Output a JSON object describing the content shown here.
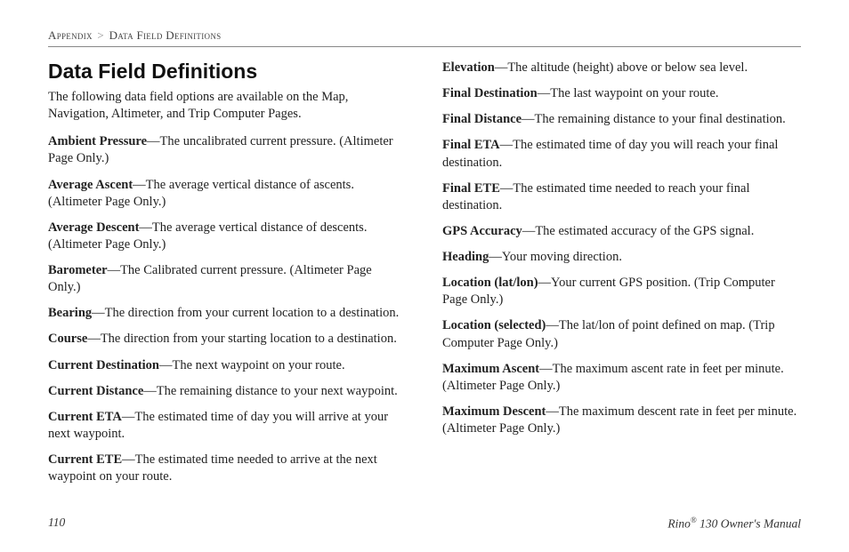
{
  "breadcrumb": {
    "part1": "Appendix",
    "sep": ">",
    "part2": "Data Field Definitions"
  },
  "title": "Data Field Definitions",
  "intro": "The following data field options are available on the Map, Navigation, Altimeter, and Trip Computer Pages.",
  "entries": [
    {
      "term": "Ambient Pressure",
      "def": "—The uncalibrated current pressure. (Altimeter Page Only.)"
    },
    {
      "term": "Average Ascent",
      "def": "—The average vertical distance of ascents. (Altimeter Page Only.)"
    },
    {
      "term": "Average Descent",
      "def": "—The average vertical distance of descents. (Altimeter Page Only.)"
    },
    {
      "term": "Barometer",
      "def": "—The Calibrated current pressure. (Altimeter Page Only.)"
    },
    {
      "term": "Bearing",
      "def": "—The direction from your current location to a destination."
    },
    {
      "term": "Course",
      "def": "—The direction from your starting location to a destination."
    },
    {
      "term": "Current Destination",
      "def": "—The next waypoint on your route."
    },
    {
      "term": "Current Distance",
      "def": "—The remaining distance to your next waypoint."
    },
    {
      "term": "Current ETA",
      "def": "—The estimated time of day you will arrive at your next waypoint."
    },
    {
      "term": "Current ETE",
      "def": "—The estimated time needed to arrive at the next waypoint on your route."
    },
    {
      "term": "Elevation",
      "def": "—The altitude (height) above or below sea level."
    },
    {
      "term": "Final Destination",
      "def": "—The last waypoint on your route."
    },
    {
      "term": "Final Distance",
      "def": "—The remaining distance to your final destination."
    },
    {
      "term": "Final ETA",
      "def": "—The estimated time of day you will reach your final destination."
    },
    {
      "term": "Final ETE",
      "def": "—The estimated time needed to reach your final destination."
    },
    {
      "term": "GPS Accuracy",
      "def": "—The estimated accuracy of the GPS signal."
    },
    {
      "term": "Heading",
      "def": "—Your moving direction."
    },
    {
      "term": "Location (lat/lon)",
      "def": "—Your current GPS position. (Trip Computer Page Only.)"
    },
    {
      "term": "Location (selected)",
      "def": "—The lat/lon of point defined on map. (Trip Computer Page Only.)"
    },
    {
      "term": "Maximum Ascent",
      "def": "—The maximum ascent rate in feet per minute. (Altimeter Page Only.)"
    },
    {
      "term": "Maximum Descent",
      "def": "—The maximum descent rate in feet per minute. (Altimeter Page Only.)"
    }
  ],
  "footer": {
    "page": "110",
    "product_prefix": "Rino",
    "product_reg": "®",
    "product_suffix": " 130 Owner's Manual"
  }
}
